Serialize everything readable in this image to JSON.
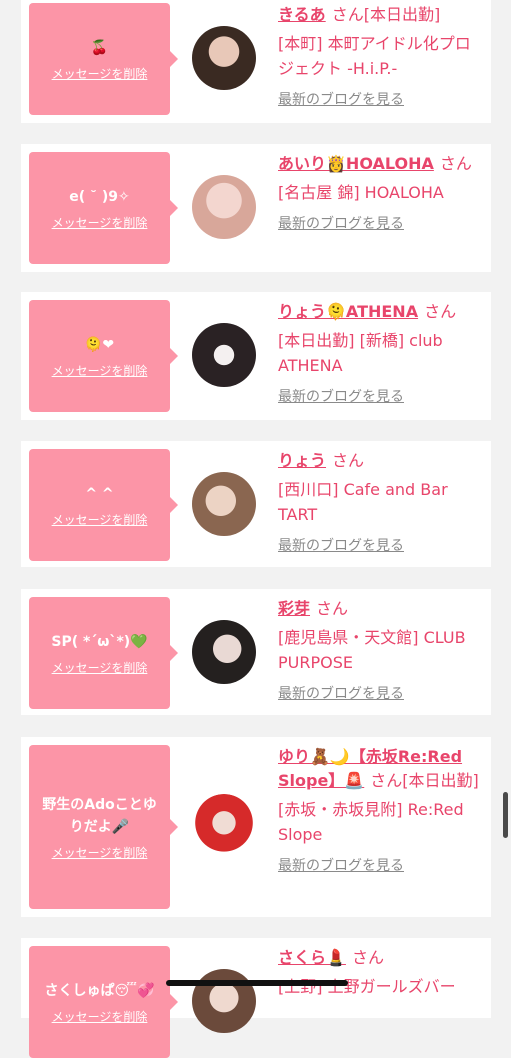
{
  "delete_label": "メッセージを削除",
  "san": "さん",
  "blog_label": "最新のブログを見る",
  "items": [
    {
      "message": "🍒",
      "name": "きるあ",
      "after_san": "[本日出勤]",
      "shop": "[本町] 本町アイドル化プロジェクト -H.i.P.-"
    },
    {
      "message": "e( ˘ )9✧",
      "name": "あいり👸HOALOHA",
      "after_san": "",
      "shop": "[名古屋 錦] HOALOHA"
    },
    {
      "message": "🫠❤",
      "name": "りょう🫠ATHENA",
      "after_san": "",
      "shop": "[本日出勤] [新橋] club ATHENA"
    },
    {
      "message": "^ ^",
      "name": "りょう",
      "after_san": "",
      "shop": "[西川口] Cafe and Bar TART"
    },
    {
      "message": "SP( *´ω`*)💚",
      "name": "彩芽",
      "after_san": "",
      "shop": "[鹿児島県・天文館] CLUB PURPOSE"
    },
    {
      "message": "野生のAdoことゆりだよ🎤",
      "name": "ゆり🧸🌙【赤坂Re:Red Slope】🚨",
      "after_san": "[本日出勤]",
      "shop": "[赤坂・赤坂見附] Re:Red Slope"
    },
    {
      "message": "さくしゅぱ😴💞",
      "name": "さくら💄",
      "after_san": "",
      "shop": "[上野] 上野ガールズバー"
    }
  ]
}
